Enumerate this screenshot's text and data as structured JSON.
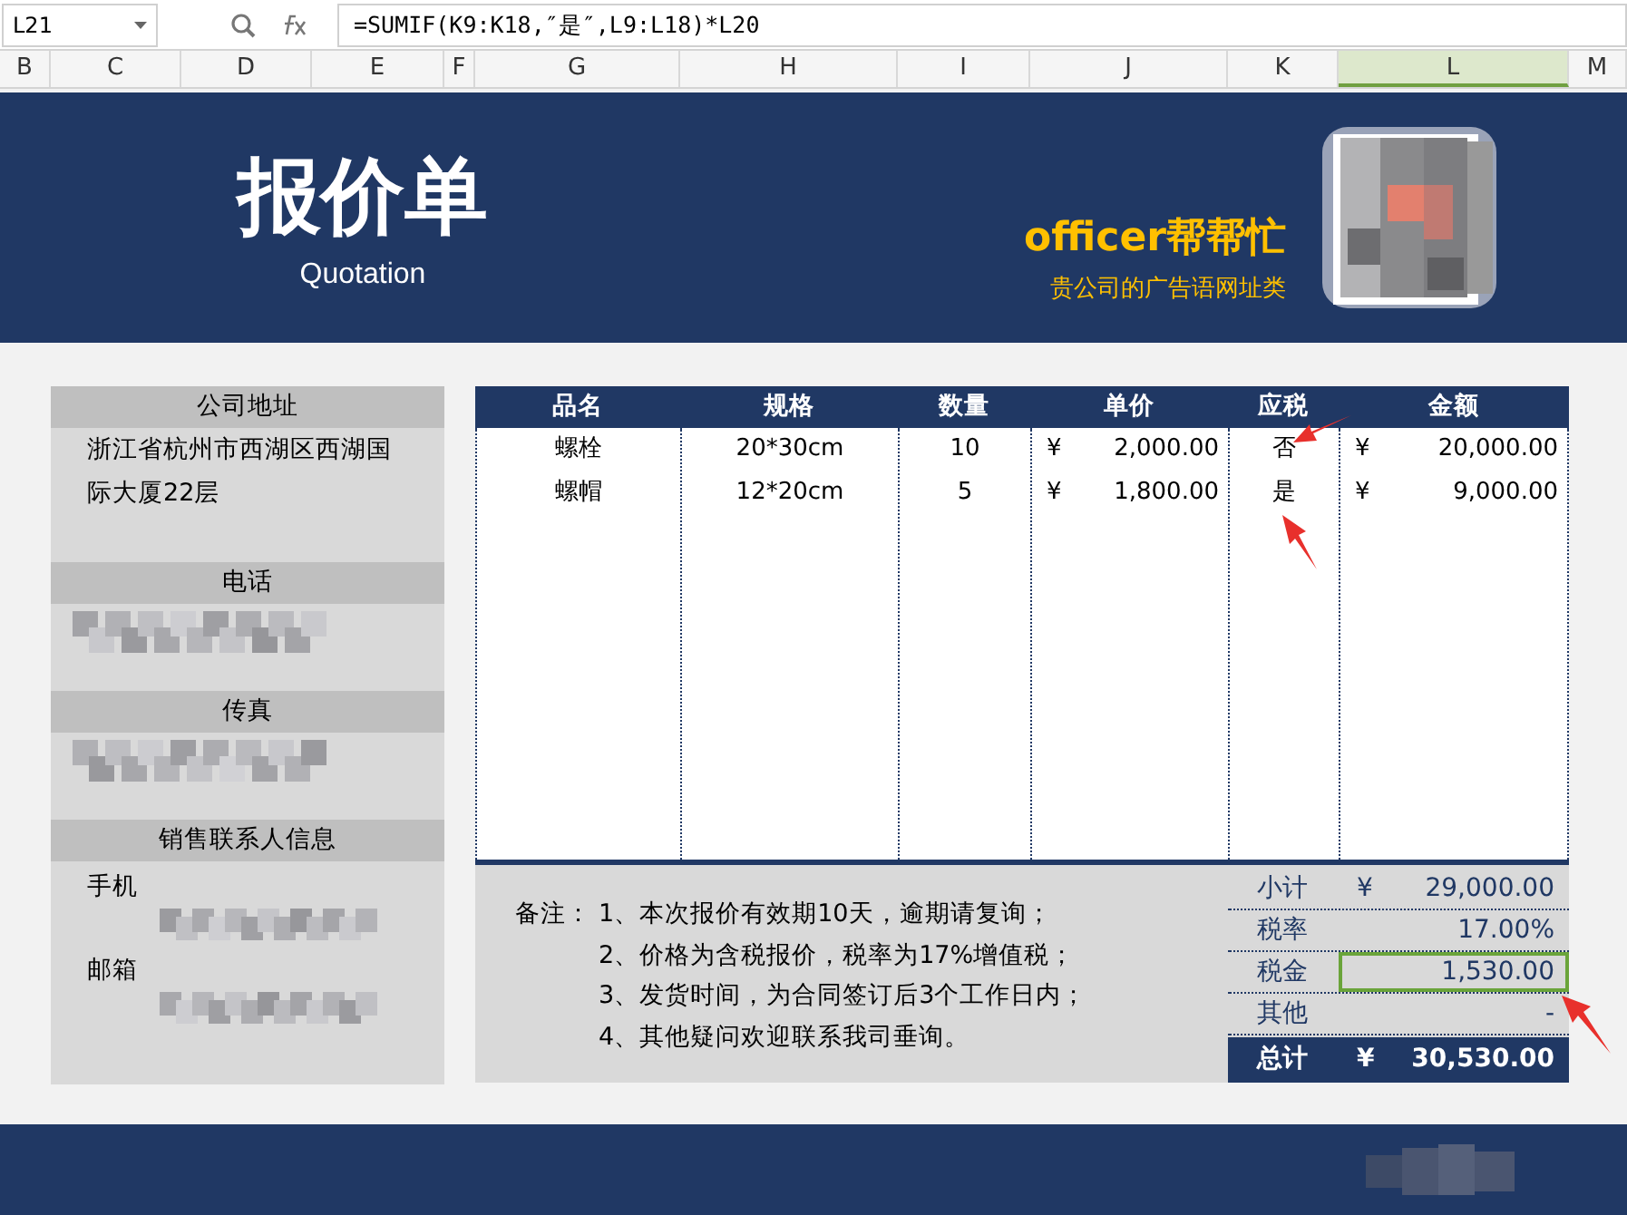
{
  "formula_bar": {
    "cell_ref": "L21",
    "formula": "=SUMIF(K9:K18,″是″,L9:L18)*L20"
  },
  "column_headers": [
    {
      "label": "B",
      "selected": false
    },
    {
      "label": "C",
      "selected": false
    },
    {
      "label": "D",
      "selected": false
    },
    {
      "label": "E",
      "selected": false
    },
    {
      "label": "F",
      "selected": false
    },
    {
      "label": "G",
      "selected": false
    },
    {
      "label": "H",
      "selected": false
    },
    {
      "label": "I",
      "selected": false
    },
    {
      "label": "J",
      "selected": false
    },
    {
      "label": "K",
      "selected": false
    },
    {
      "label": "L",
      "selected": true
    },
    {
      "label": "M",
      "selected": false
    }
  ],
  "banner": {
    "title": "报价单",
    "subtitle": "Quotation",
    "brand": "officer帮帮忙",
    "slogan": "贵公司的广告语网址类"
  },
  "info_panel": [
    {
      "title": "公司地址",
      "lines": [
        "浙江省杭州市西湖区西湖国",
        "际大厦22层"
      ]
    },
    {
      "title": "电话"
    },
    {
      "title": "传真"
    },
    {
      "title": "销售联系人信息",
      "lines": [
        "手机",
        "邮箱"
      ]
    }
  ],
  "table": {
    "columns": [
      "品名",
      "规格",
      "数量",
      "单价",
      "应税",
      "金额"
    ],
    "rows": [
      {
        "name": "螺栓",
        "spec": "20*30cm",
        "qty": "10",
        "price_symbol": "¥",
        "price": "2,000.00",
        "taxable": "否",
        "amount_symbol": "¥",
        "amount": "20,000.00"
      },
      {
        "name": "螺帽",
        "spec": "12*20cm",
        "qty": "5",
        "price_symbol": "¥",
        "price": "1,800.00",
        "taxable": "是",
        "amount_symbol": "¥",
        "amount": "9,000.00"
      }
    ]
  },
  "notes": {
    "label": "备注：",
    "items": [
      "1、本次报价有效期10天，逾期请复询；",
      "2、价格为含税报价，税率为17%增值税；",
      "3、发货时间，为合同签订后3个工作日内；",
      "4、其他疑问欢迎联系我司垂询。"
    ]
  },
  "summary": [
    {
      "label": "小计",
      "symbol": "¥",
      "value": "29,000.00",
      "selected": false
    },
    {
      "label": "税率",
      "value": "17.00%",
      "selected": false
    },
    {
      "label": "税金",
      "value": "1,530.00",
      "selected": true
    },
    {
      "label": "其他",
      "value": "-",
      "selected": false
    }
  ],
  "total": {
    "label": "总计",
    "symbol": "¥",
    "value": "30,530.00"
  }
}
